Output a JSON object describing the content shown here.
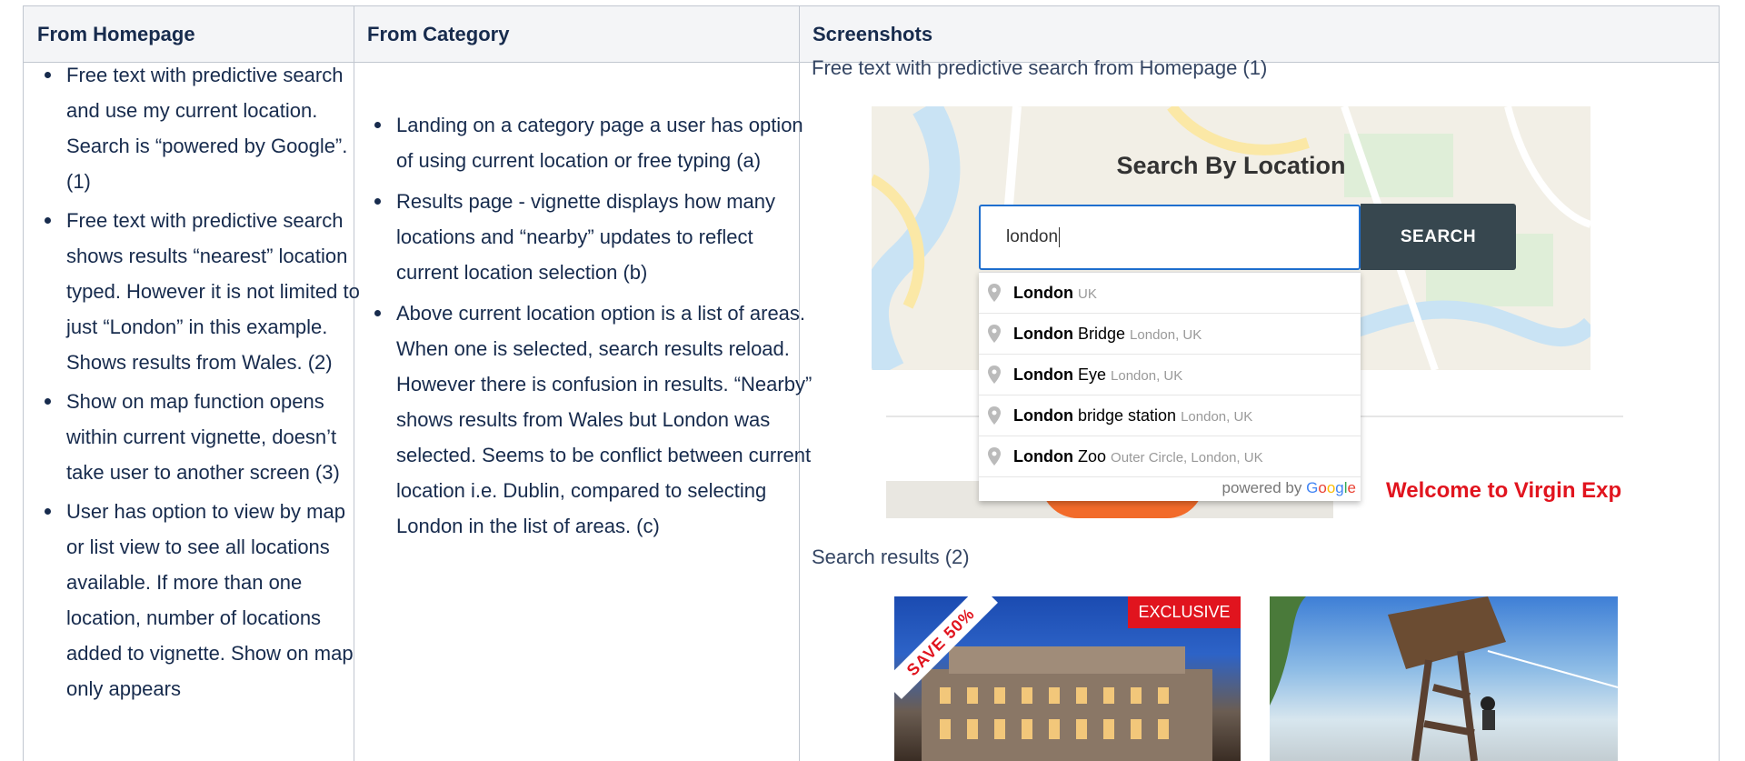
{
  "table": {
    "headers": [
      "From Homepage",
      "From Category",
      "Screenshots"
    ],
    "homepage_items": [
      "Free text with predictive search and use my current location. Search is “powered by Google”. (1)",
      "Free text with predictive search shows results “nearest” location typed. However it is not limited to just “London” in this example. Shows results from Wales. (2)",
      "Show on map function opens within current vignette, doesn’t take user to another screen (3)",
      "User has option to view by map or list view to see all locations available. If more than one location, number of locations added to vignette. Show on map only appears"
    ],
    "category_items": [
      "Landing on a category page a user has option of using current location or free typing (a)",
      "Results page - vignette displays how many locations and “nearby” updates to reflect current location selection (b)",
      "Above current location option is a list of areas. When one is selected, search results reload. However there is confusion in results. “Nearby” shows results from Wales but London was selected. Seems to be conflict between current location i.e. Dublin, compared to selecting London in the list of areas. (c)"
    ]
  },
  "screenshots": {
    "caption1": "Free text with predictive search from Homepage (1)",
    "caption2": "Search results (2)",
    "search_title": "Search By Location",
    "search_value": "london",
    "search_button": "SEARCH",
    "suggestions": [
      {
        "main": "London",
        "rest": "",
        "secondary": "UK"
      },
      {
        "main": "London",
        "rest": " Bridge",
        "secondary": "London, UK"
      },
      {
        "main": "London",
        "rest": " Eye",
        "secondary": "London, UK"
      },
      {
        "main": "London",
        "rest": " bridge station",
        "secondary": "London, UK"
      },
      {
        "main": "London",
        "rest": " Zoo",
        "secondary": "Outer Circle, London, UK"
      }
    ],
    "powered_by": "powered by",
    "google": [
      "G",
      "o",
      "o",
      "g",
      "l",
      "e"
    ],
    "welcome": "Welcome to Virgin Exp",
    "badge_exclusive": "EXCLUSIVE",
    "badge_save": "SAVE 50%"
  },
  "colors": {
    "brand_red": "#e1141e",
    "search_button": "#37474f",
    "input_border": "#1f6fcf",
    "header_bg": "#f4f5f7"
  },
  "icons": [
    "map-pin-icon"
  ]
}
